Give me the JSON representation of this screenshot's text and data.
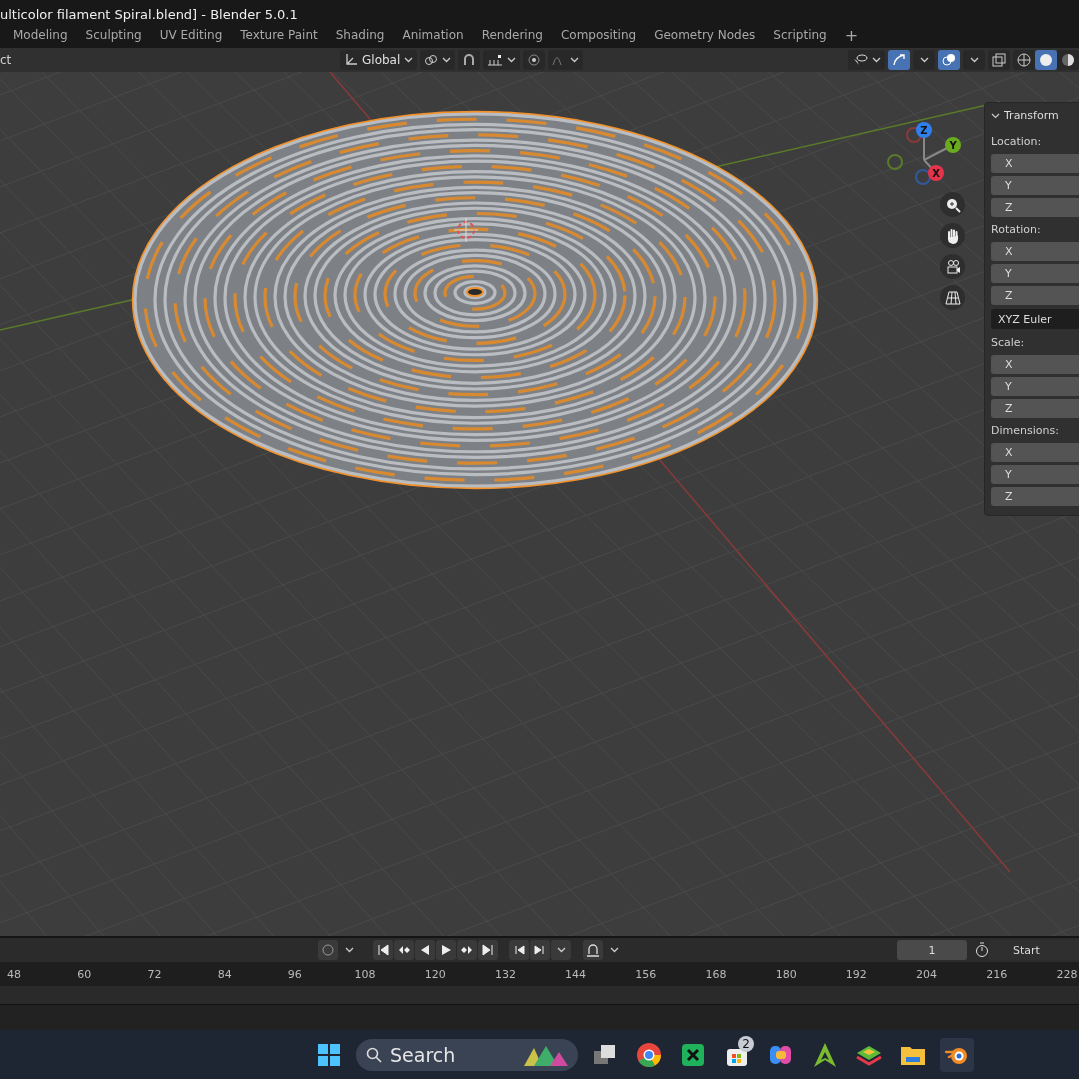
{
  "window": {
    "title": "ulticolor filament Spiral.blend] - Blender 5.0.1"
  },
  "workspace_tabs": [
    "Modeling",
    "Sculpting",
    "UV Editing",
    "Texture Paint",
    "Shading",
    "Animation",
    "Rendering",
    "Compositing",
    "Geometry Nodes",
    "Scripting",
    "+"
  ],
  "viewport_header": {
    "left_text": "ct",
    "orientation": "Global",
    "snap_on": false,
    "proportional_on": false,
    "gizmos_on": true,
    "overlays_on": true,
    "shading_modes": [
      {
        "selected": false
      },
      {
        "selected": true
      },
      {
        "selected": false
      }
    ]
  },
  "gizmo_axes": [
    "Z",
    "Y",
    "X"
  ],
  "transform_panel": {
    "title": "Transform",
    "expanded": true,
    "sections": [
      {
        "label": "Location:",
        "fields": [
          "X",
          "Y",
          "Z"
        ]
      },
      {
        "label": "Rotation:",
        "fields": [
          "X",
          "Y",
          "Z"
        ],
        "mode": "XYZ Euler"
      },
      {
        "label": "Scale:",
        "fields": [
          "X",
          "Y",
          "Z"
        ]
      },
      {
        "label": "Dimensions:",
        "fields": [
          "X",
          "Y",
          "Z"
        ]
      }
    ]
  },
  "timeline": {
    "current_frame": "1",
    "start_label": "Start",
    "ruler": [
      "48",
      "60",
      "72",
      "84",
      "96",
      "108",
      "120",
      "132",
      "144",
      "156",
      "168",
      "180",
      "192",
      "204",
      "216",
      "228"
    ]
  },
  "taskbar": {
    "search_placeholder": "Search",
    "store_badge": "2"
  }
}
